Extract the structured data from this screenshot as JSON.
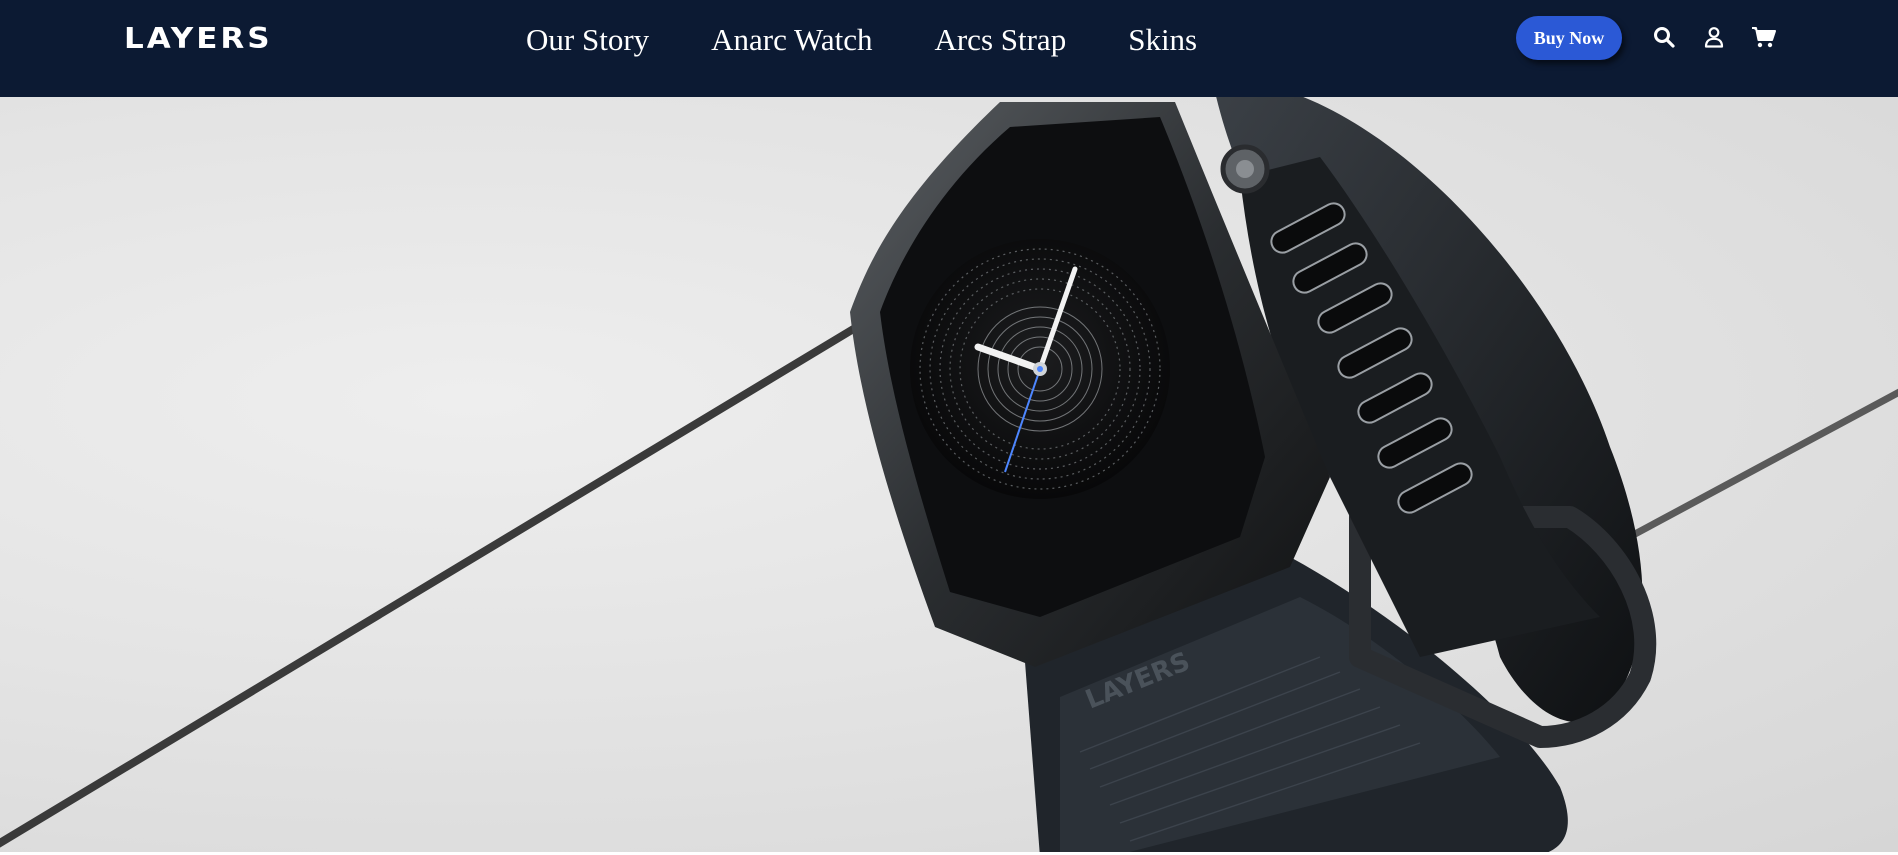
{
  "brand": {
    "logo_text": "LAYERS"
  },
  "nav": {
    "links": [
      "Our Story",
      "Anarc Watch",
      "Arcs Strap",
      "Skins"
    ]
  },
  "actions": {
    "buy_now_label": "Buy Now",
    "icons": [
      "search-icon",
      "account-icon",
      "cart-icon"
    ]
  },
  "hero": {
    "image": "watch-product-photo",
    "band_engraving": "LAYERS"
  },
  "colors": {
    "navbar_bg": "#0c1a33",
    "accent": "#2b59d6",
    "hero_bg": "#e4e4e4"
  }
}
